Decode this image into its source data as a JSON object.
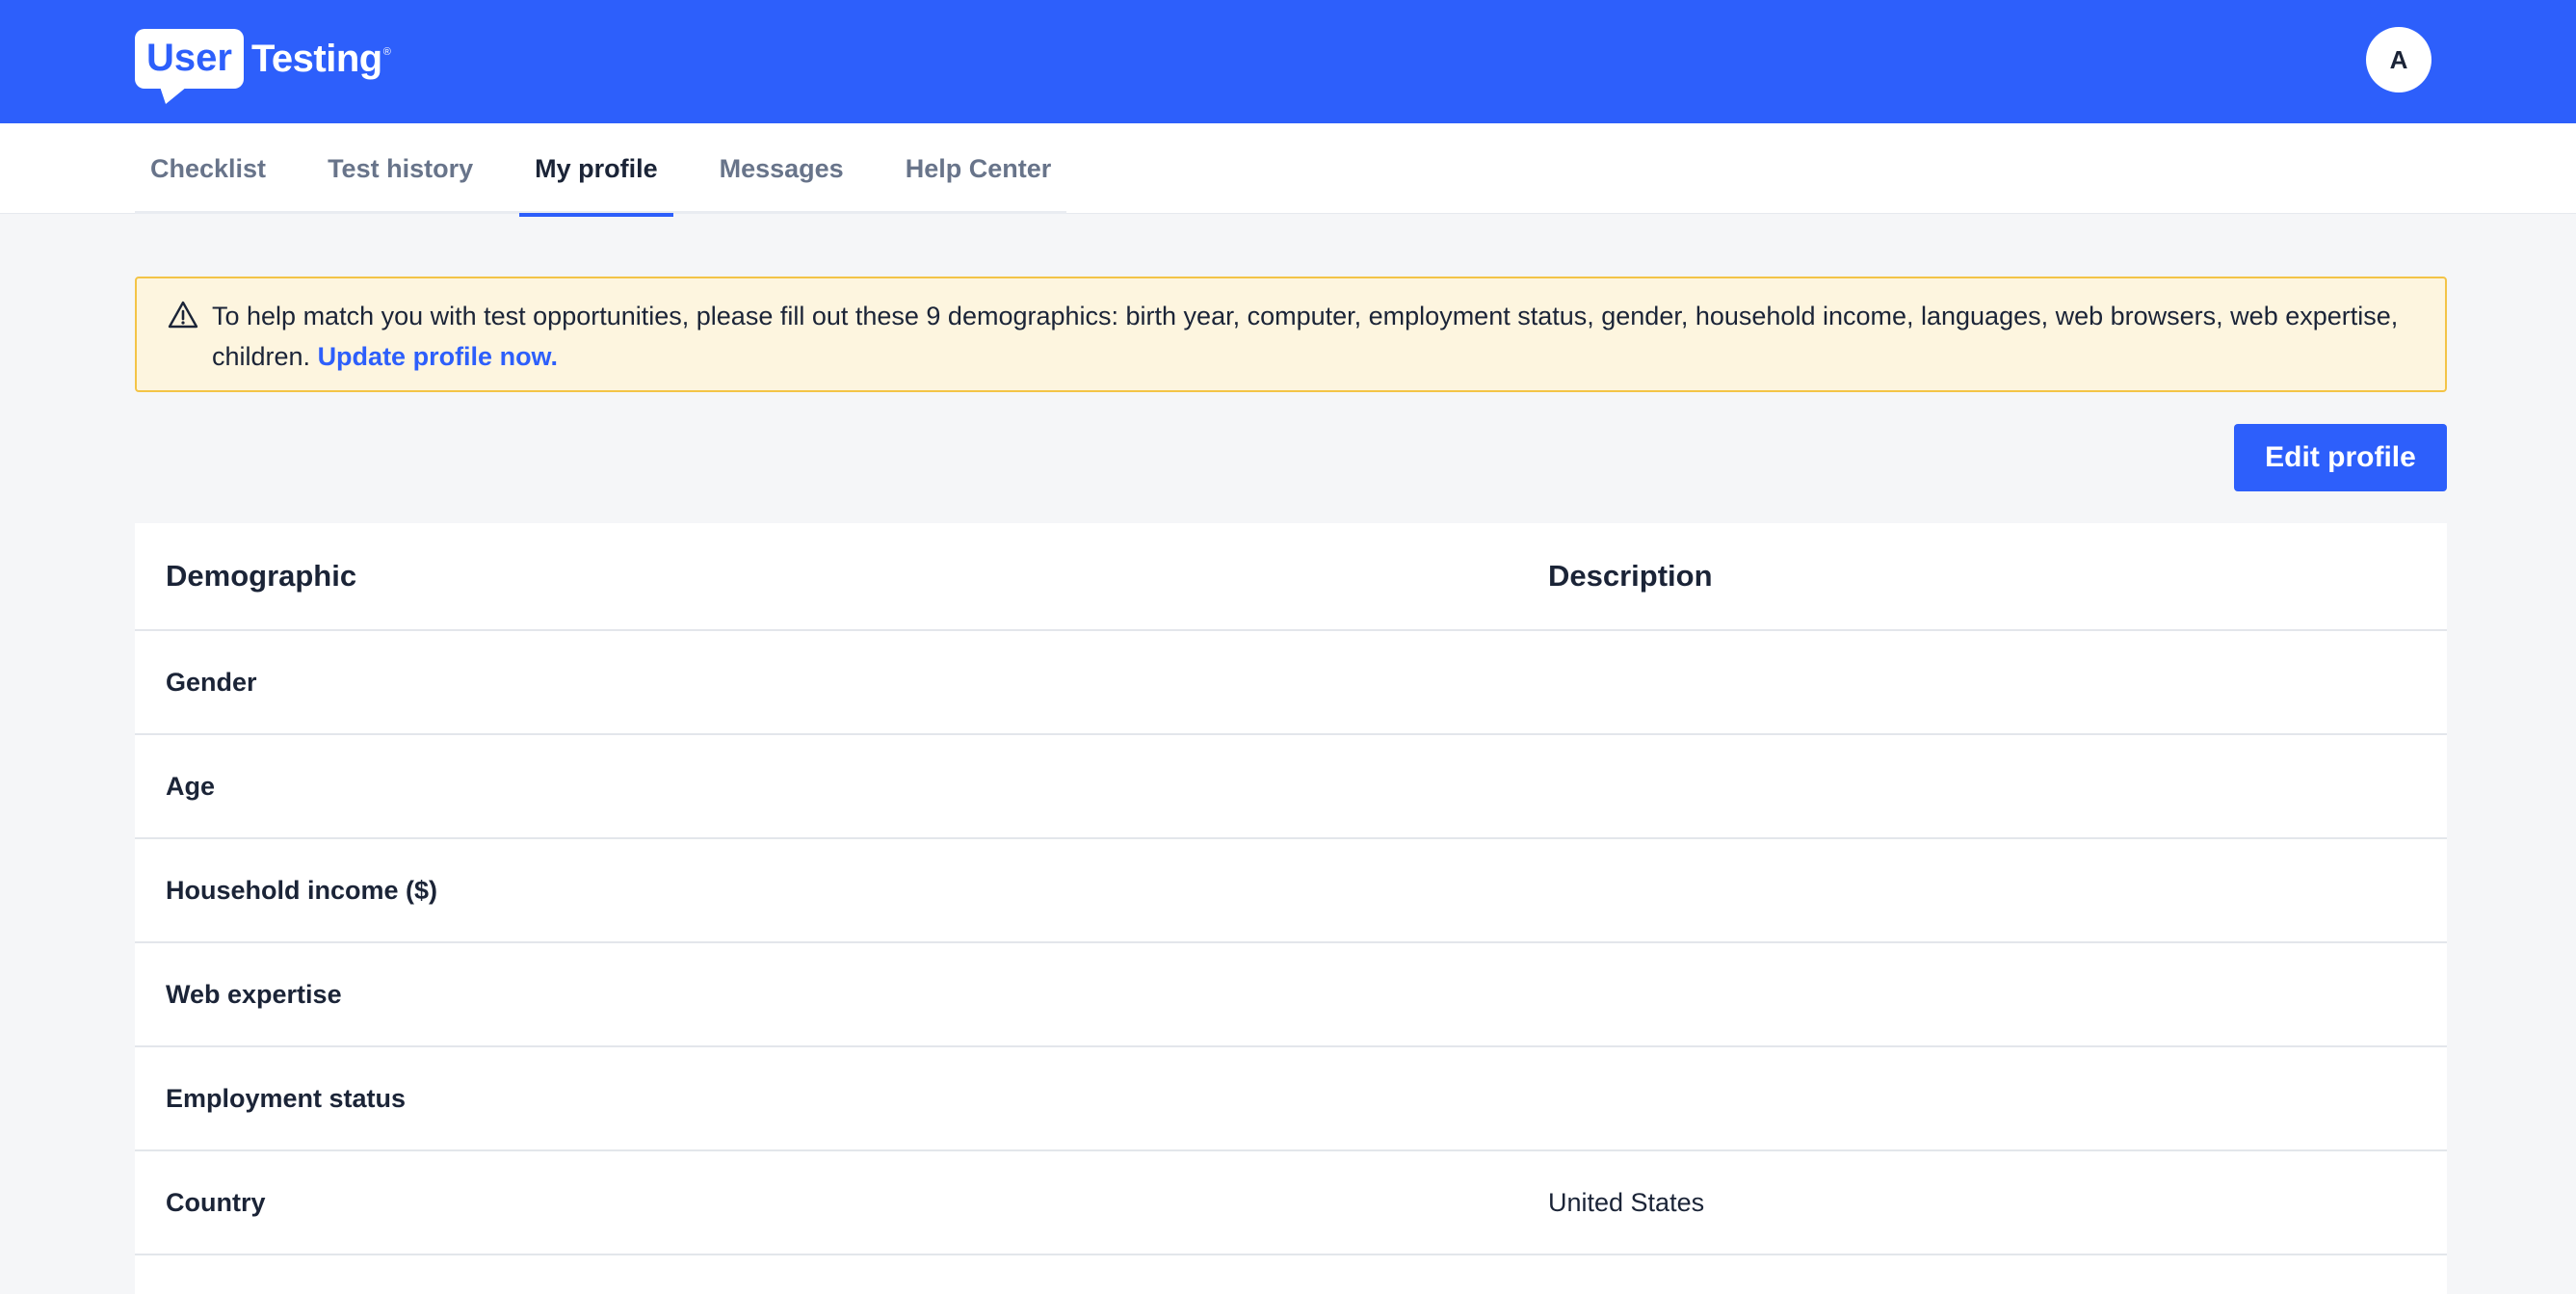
{
  "header": {
    "logo_user": "User",
    "logo_testing": "Testing",
    "logo_reg": "®",
    "avatar_initial": "A",
    "brand_color": "#2d5ffb"
  },
  "tabs": [
    {
      "label": "Checklist",
      "active": false
    },
    {
      "label": "Test history",
      "active": false
    },
    {
      "label": "My profile",
      "active": true
    },
    {
      "label": "Messages",
      "active": false
    },
    {
      "label": "Help Center",
      "active": false
    }
  ],
  "alert": {
    "icon": "warning-triangle-icon",
    "message": "To help match you with test opportunities, please fill out these 9 demographics: birth year, computer, employment status, gender, household income, languages, web browsers, web expertise, children. ",
    "link_label": "Update profile now."
  },
  "edit_button_label": "Edit profile",
  "table": {
    "headers": {
      "demographic": "Demographic",
      "description": "Description"
    },
    "rows": [
      {
        "demographic": "Gender",
        "description": ""
      },
      {
        "demographic": "Age",
        "description": ""
      },
      {
        "demographic": "Household income ($)",
        "description": ""
      },
      {
        "demographic": "Web expertise",
        "description": ""
      },
      {
        "demographic": "Employment status",
        "description": ""
      },
      {
        "demographic": "Country",
        "description": "United States"
      }
    ]
  }
}
